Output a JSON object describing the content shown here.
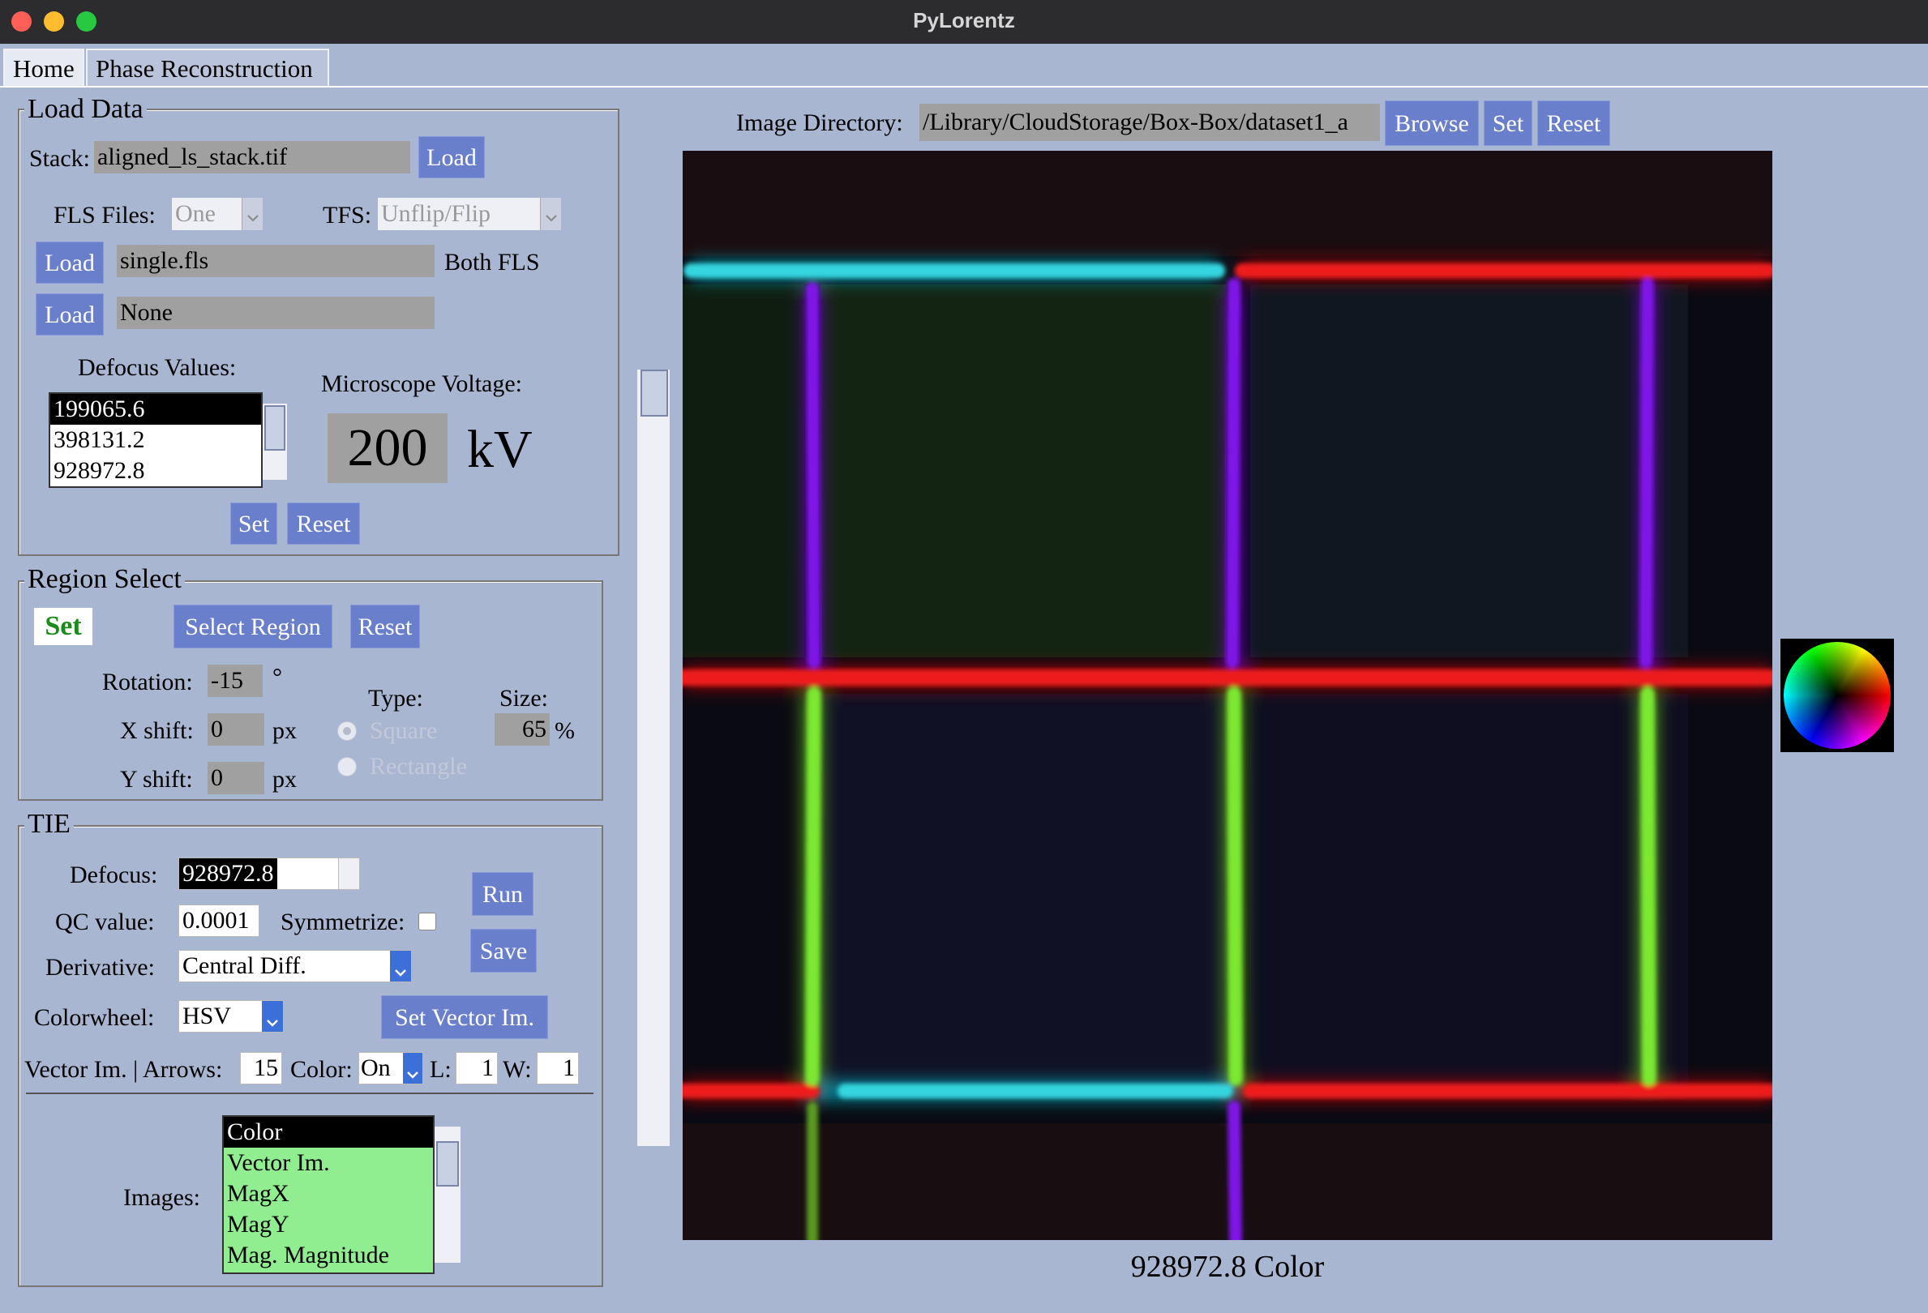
{
  "window": {
    "title": "PyLorentz"
  },
  "tabs": [
    {
      "label": "Home"
    },
    {
      "label": "Phase Reconstruction"
    }
  ],
  "load_data": {
    "title": "Load Data",
    "stack_label": "Stack:",
    "stack_value": "aligned_ls_stack.tif",
    "load_label": "Load",
    "fls_files_label": "FLS Files:",
    "fls_files_value": "One",
    "tfs_label": "TFS:",
    "tfs_value": "Unflip/Flip",
    "fls1_value": "single.fls",
    "both_fls_label": "Both FLS",
    "fls2_value": "None",
    "defocus_label": "Defocus Values:",
    "defocus_values": [
      "199065.6",
      "398131.2",
      "928972.8"
    ],
    "voltage_label": "Microscope Voltage:",
    "voltage_value": "200",
    "voltage_unit": "kV",
    "set_label": "Set",
    "reset_label": "Reset"
  },
  "region_select": {
    "title": "Region Select",
    "set_label": "Set",
    "select_region_label": "Select Region",
    "reset_label": "Reset",
    "rotation_label": "Rotation:",
    "rotation_value": "-15",
    "rotation_unit": "°",
    "xshift_label": "X shift:",
    "xshift_value": "0",
    "yshift_label": "Y shift:",
    "yshift_value": "0",
    "px_unit": "px",
    "type_label": "Type:",
    "type_square": "Square",
    "type_rectangle": "Rectangle",
    "size_label": "Size:",
    "size_value": "65",
    "size_unit": "%"
  },
  "tie": {
    "title": "TIE",
    "defocus_label": "Defocus:",
    "defocus_value": "928972.8",
    "qc_label": "QC value:",
    "qc_value": "0.0001",
    "symmetrize_label": "Symmetrize:",
    "run_label": "Run",
    "save_label": "Save",
    "derivative_label": "Derivative:",
    "derivative_value": "Central Diff.",
    "colorwheel_label": "Colorwheel:",
    "colorwheel_value": "HSV",
    "set_vector_label": "Set Vector Im.",
    "vector_label": "Vector Im. | Arrows:",
    "arrows_value": "15",
    "color_label": "Color:",
    "color_value": "On",
    "l_label": "L:",
    "l_value": "1",
    "w_label": "W:",
    "w_value": "1",
    "images_label": "Images:",
    "images": [
      "Color",
      "Vector Im.",
      "MagX",
      "MagY",
      "Mag. Magnitude"
    ]
  },
  "viewer": {
    "dir_label": "Image Directory:",
    "dir_value": "/Library/CloudStorage/Box-Box/dataset1_a",
    "browse_label": "Browse",
    "set_label": "Set",
    "reset_label": "Reset",
    "caption": "928972.8 Color"
  },
  "colors": {
    "background": "#a9b6d2",
    "button": "#6a7fcc",
    "set_green": "#1a8a1a",
    "list_green": "#90ee90"
  }
}
